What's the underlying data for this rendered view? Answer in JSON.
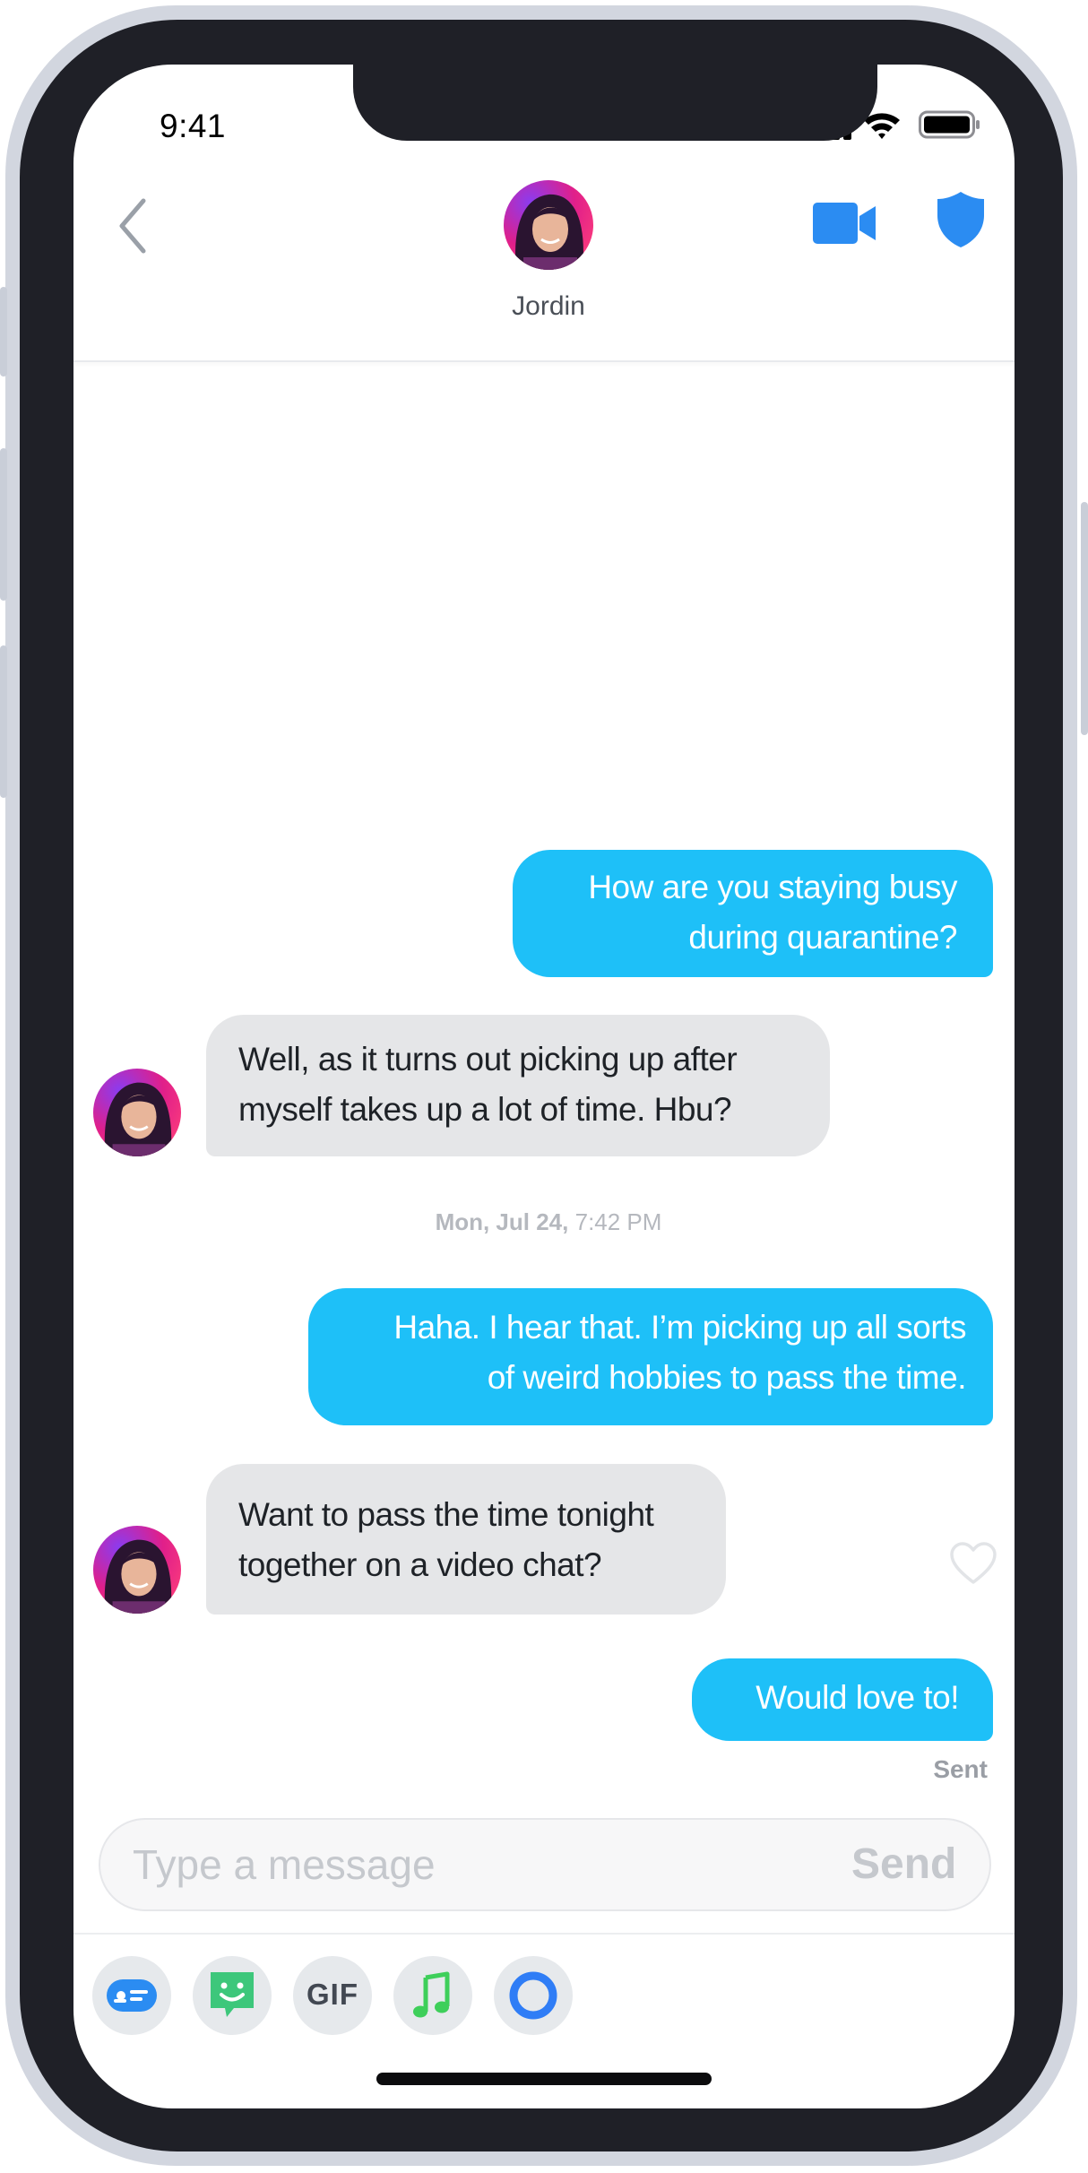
{
  "status_bar": {
    "time": "9:41"
  },
  "header": {
    "back_icon": "chevron-left-icon",
    "contact_name": "Jordin",
    "video_icon": "video-camera-icon",
    "safety_icon": "shield-icon"
  },
  "messages": [
    {
      "direction": "outgoing",
      "lines": [
        "How are you staying busy",
        "during quarantine?"
      ]
    },
    {
      "direction": "incoming",
      "lines": [
        "Well, as it turns out picking up after",
        "myself takes up a lot of time. Hbu?"
      ]
    },
    {
      "direction": "outgoing",
      "lines": [
        "Haha. I hear that. I’m picking up all sorts",
        "of weird hobbies to pass the time."
      ]
    },
    {
      "direction": "incoming",
      "lines": [
        "Want to pass the time tonight",
        "together on a video chat?"
      ]
    },
    {
      "direction": "outgoing",
      "lines": [
        "Would love to!"
      ]
    }
  ],
  "timestamp": {
    "day": "Mon, Jul 24,",
    "time": "7:42 PM"
  },
  "sent_status": "Sent",
  "composer": {
    "placeholder": "Type a message",
    "value": "",
    "send_label": "Send"
  },
  "toolbar": {
    "items": [
      "card-icon",
      "sticker-icon",
      "GIF",
      "music-note-icon",
      "loop-icon"
    ],
    "gif_label": "GIF"
  },
  "colors": {
    "outgoing_bubble": "#1ec0f8",
    "incoming_bubble": "#e5e6e8",
    "accent_blue": "#2b8cf2",
    "sticker_green": "#3dc77b",
    "music_green": "#3ecf5a"
  }
}
